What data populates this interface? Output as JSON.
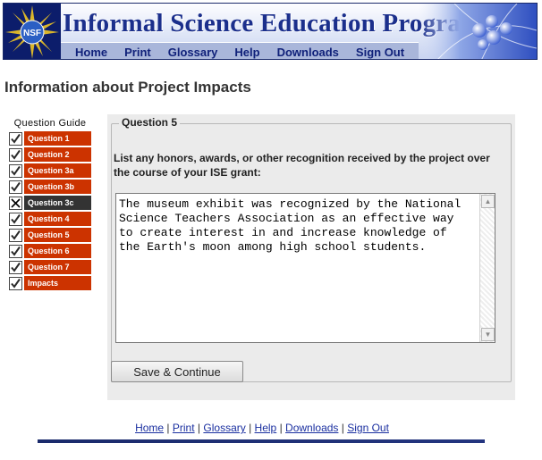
{
  "banner": {
    "title": "Informal Science Education Program",
    "logo_text": "NSF"
  },
  "nav": {
    "items": [
      "Home",
      "Print",
      "Glossary",
      "Help",
      "Downloads",
      "Sign Out"
    ]
  },
  "page_title": "Information about Project Impacts",
  "guide": {
    "title": "Question Guide",
    "items": [
      {
        "label": "Question 1",
        "state": "checked"
      },
      {
        "label": "Question 2",
        "state": "checked"
      },
      {
        "label": "Question 3a",
        "state": "checked"
      },
      {
        "label": "Question 3b",
        "state": "checked"
      },
      {
        "label": "Question 3c",
        "state": "current"
      },
      {
        "label": "Question 4",
        "state": "checked"
      },
      {
        "label": "Question 5",
        "state": "checked"
      },
      {
        "label": "Question 6",
        "state": "checked"
      },
      {
        "label": "Question 7",
        "state": "checked"
      },
      {
        "label": "Impacts",
        "state": "checked"
      }
    ]
  },
  "question": {
    "legend": "Question 5",
    "prompt": "List any honors, awards, or other recognition received by the project over the course of your ISE grant:",
    "answer": "The museum exhibit was recognized by the National\nScience Teachers Association as an effective way\nto create interest in and increase knowledge of\nthe Earth's moon among high school students.",
    "save_label": "Save & Continue"
  },
  "footer": {
    "links": [
      "Home",
      "Print",
      "Glossary",
      "Help",
      "Downloads",
      "Sign Out"
    ],
    "separator": "|"
  },
  "colors": {
    "brand_navy": "#1b2f8c",
    "guide_red": "#cc3300",
    "guide_current": "#333333",
    "panel_bg": "#ebebeb"
  }
}
